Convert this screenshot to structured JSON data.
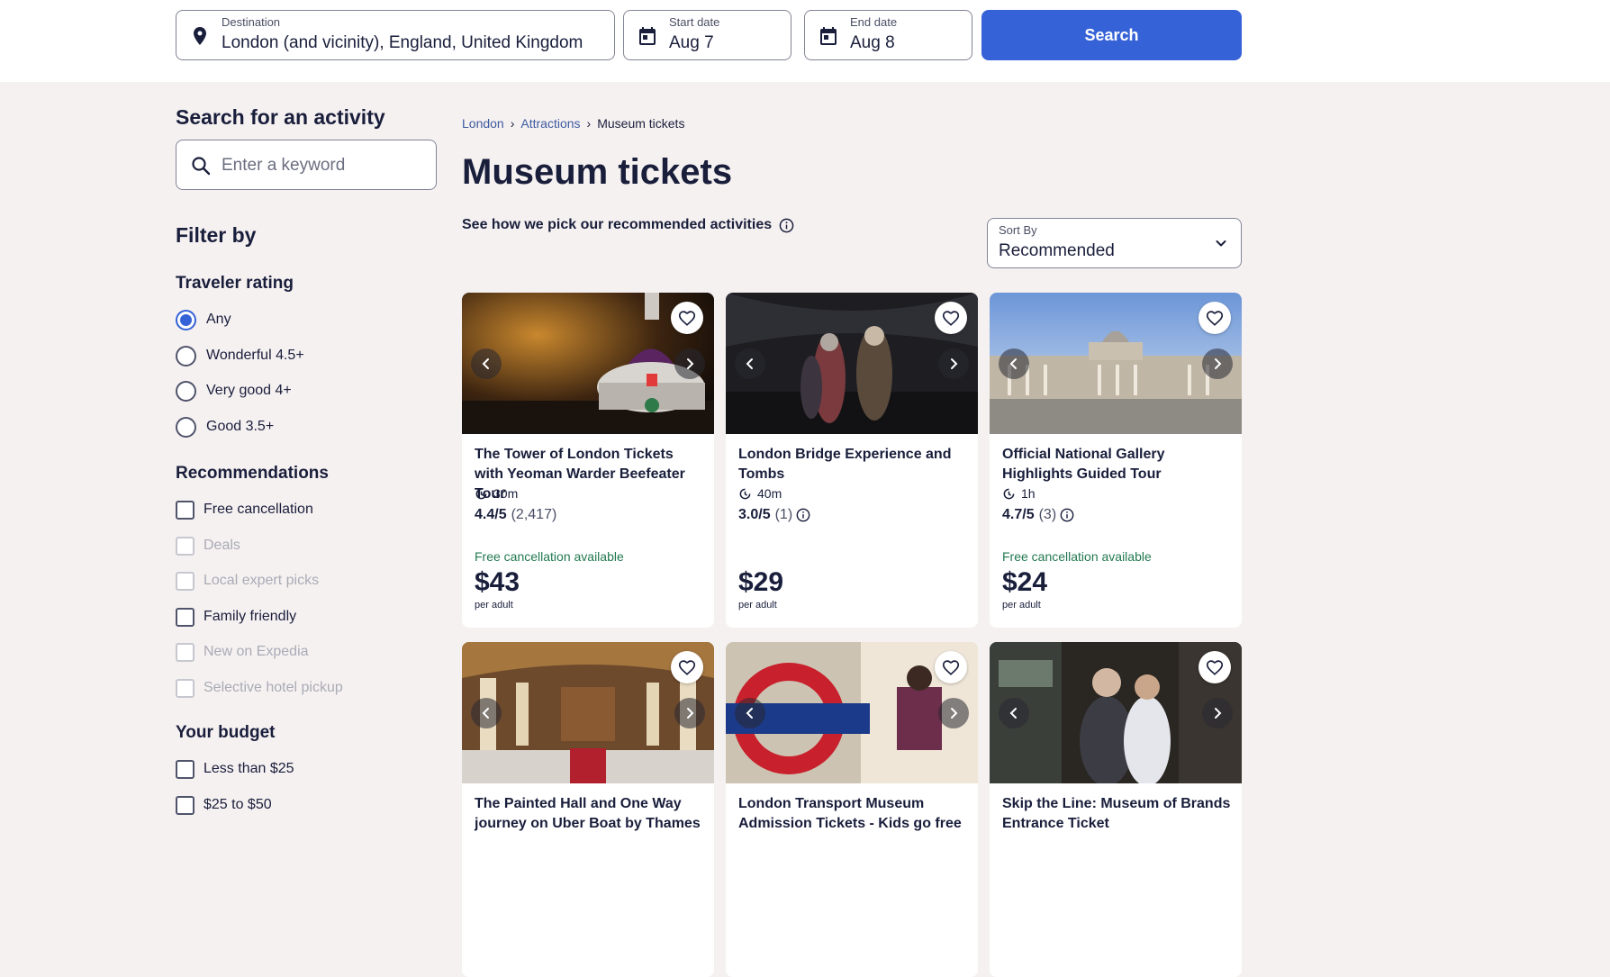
{
  "search": {
    "destination_label": "Destination",
    "destination_value": "London (and vicinity), England, United Kingdom",
    "start_label": "Start date",
    "start_value": "Aug 7",
    "end_label": "End date",
    "end_value": "Aug 8",
    "button_label": "Search"
  },
  "sidebar": {
    "search_heading": "Search for an activity",
    "keyword_placeholder": "Enter a keyword",
    "filter_heading": "Filter by",
    "rating_heading": "Traveler rating",
    "rating_options": [
      "Any",
      "Wonderful 4.5+",
      "Very good 4+",
      "Good 3.5+"
    ],
    "rec_heading": "Recommendations",
    "rec_options": [
      "Free cancellation",
      "Deals",
      "Local expert picks",
      "Family friendly",
      "New on Expedia",
      "Selective hotel pickup"
    ],
    "budget_heading": "Your budget",
    "budget_options": [
      "Less than $25",
      "$25 to $50"
    ]
  },
  "breadcrumb": [
    "London",
    "Attractions",
    "Museum tickets"
  ],
  "page_title": "Museum tickets",
  "pick_note": "See how we pick our recommended activities",
  "sort": {
    "label": "Sort By",
    "value": "Recommended"
  },
  "colors": {
    "accent": "#3662d8",
    "free_cancel": "#227950",
    "text": "#191e3b",
    "page_bg": "#f6f1f1"
  },
  "cards": [
    {
      "title": "The Tower of London Tickets with Yeoman Warder Beefeater Tour",
      "duration": "30m",
      "rating": "4.4/5",
      "count": "(2,417)",
      "free_cancel": "Free cancellation available",
      "price": "$43",
      "per": "per adult"
    },
    {
      "title": "London Bridge Experience and Tombs",
      "duration": "40m",
      "rating": "3.0/5",
      "count": "(1)",
      "free_cancel": "",
      "price": "$29",
      "per": "per adult"
    },
    {
      "title": "Official National Gallery Highlights Guided Tour",
      "duration": "1h",
      "rating": "4.7/5",
      "count": "(3)",
      "free_cancel": "Free cancellation available",
      "price": "$24",
      "per": "per adult"
    },
    {
      "title": "The Painted Hall and One Way journey on Uber Boat by Thames"
    },
    {
      "title": "London Transport Museum Admission Tickets - Kids go free"
    },
    {
      "title": "Skip the Line: Museum of Brands Entrance Ticket"
    }
  ]
}
